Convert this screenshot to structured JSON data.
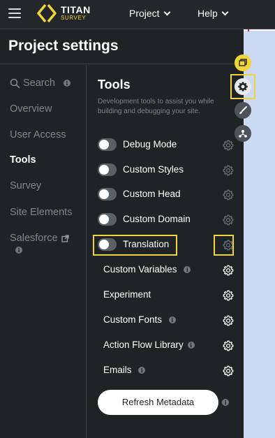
{
  "app": {
    "name": "TITAN",
    "product": "SURVEY"
  },
  "topnav": {
    "project_label": "Project",
    "help_label": "Help"
  },
  "panel": {
    "title": "Project settings"
  },
  "sidebar": {
    "items": [
      {
        "label": "Search",
        "active": false
      },
      {
        "label": "Overview",
        "active": false
      },
      {
        "label": "User Access",
        "active": false
      },
      {
        "label": "Tools",
        "active": true
      },
      {
        "label": "Survey",
        "active": false
      },
      {
        "label": "Site Elements",
        "active": false
      },
      {
        "label": "Salesforce",
        "active": false
      }
    ]
  },
  "tools": {
    "title": "Tools",
    "description": "Development tools to assist you while building and debugging your site.",
    "toggles": [
      {
        "label": "Debug Mode",
        "enabled": false
      },
      {
        "label": "Custom Styles",
        "enabled": false
      },
      {
        "label": "Custom Head",
        "enabled": false
      },
      {
        "label": "Custom Domain",
        "enabled": false
      },
      {
        "label": "Translation",
        "enabled": false
      }
    ],
    "links": [
      {
        "label": "Custom Variables",
        "info": true
      },
      {
        "label": "Experiment",
        "info": false
      },
      {
        "label": "Custom Fonts",
        "info": true
      },
      {
        "label": "Action Flow Library",
        "info": true
      },
      {
        "label": "Emails",
        "info": true
      }
    ],
    "refresh_label": "Refresh Metadata"
  },
  "colors": {
    "accent": "#f2d33a",
    "background": "#1f2326",
    "canvas": "#ccd9f5",
    "muted_text": "#7f868c"
  },
  "icons": {
    "menu": "hamburger-icon",
    "info": "info-icon",
    "settings": "gear-icon",
    "external": "external-link-icon",
    "pages": "pages-icon",
    "brush": "brush-icon",
    "flow": "flow-icon"
  }
}
